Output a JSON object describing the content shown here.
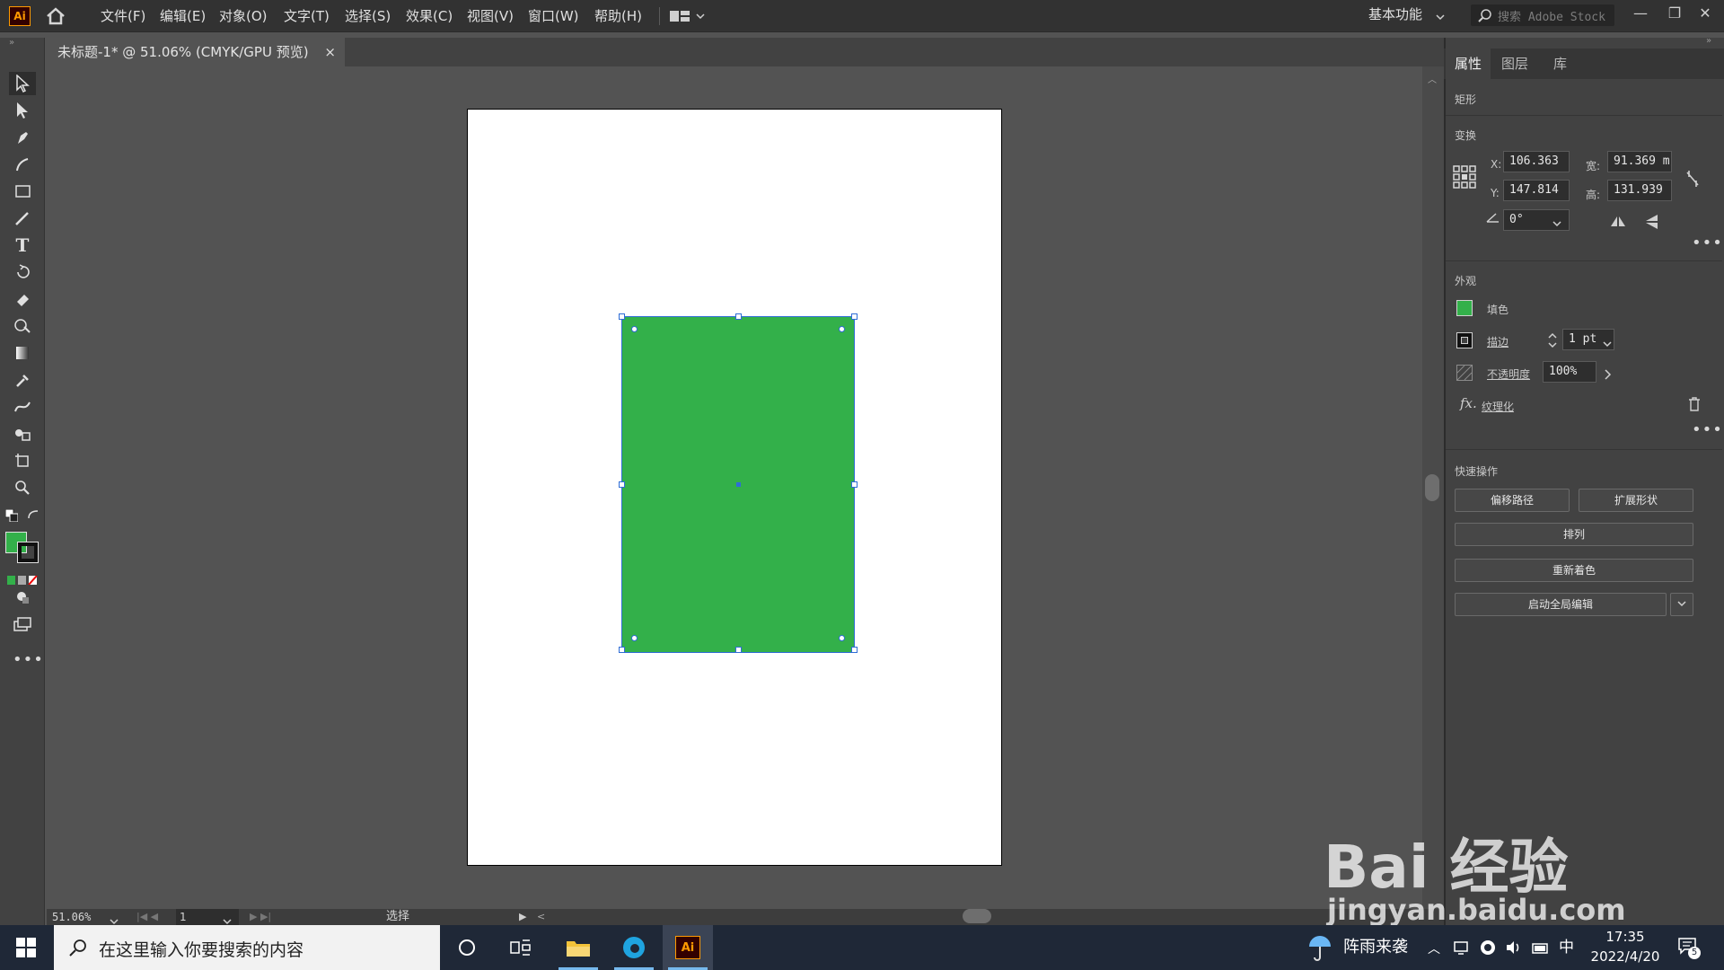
{
  "app": {
    "logo": "Ai",
    "menu": [
      "文件(F)",
      "编辑(E)",
      "对象(O)",
      "文字(T)",
      "选择(S)",
      "效果(C)",
      "视图(V)",
      "窗口(W)",
      "帮助(H)"
    ],
    "workspace": "基本功能",
    "search_placeholder": "搜索 Adobe Stock"
  },
  "document": {
    "tab_title": "未标题-1* @ 51.06% (CMYK/GPU 预览)",
    "close": "×",
    "zoom": "51.06%",
    "page": "1",
    "status_mode": "选择"
  },
  "colors": {
    "fill": "#33b04a",
    "selection": "#2f6dd6",
    "accent": "#ff9a00"
  },
  "properties": {
    "tabs": [
      "属性",
      "图层",
      "库"
    ],
    "object_type": "矩形",
    "transform_title": "变换",
    "x_label": "X:",
    "x": "106.363",
    "y_label": "Y:",
    "y": "147.814",
    "w_label": "宽:",
    "w": "91.369 m",
    "h_label": "高:",
    "h": "131.939",
    "angle": "0°",
    "appearance_title": "外观",
    "fill_label": "填色",
    "stroke_label": "描边",
    "stroke_value": "1 pt",
    "opacity_label": "不透明度",
    "opacity_value": "100%",
    "effect_label": "纹理化",
    "quick_title": "快速操作",
    "btn_offset": "偏移路径",
    "btn_expand": "扩展形状",
    "btn_arrange": "排列",
    "btn_recolor": "重新着色",
    "btn_global": "启动全局编辑"
  },
  "taskbar": {
    "search_placeholder": "在这里输入你要搜索的内容",
    "weather": "阵雨来袭",
    "ime": "中",
    "time": "17:35",
    "date": "2022/4/20",
    "notifications": "5"
  },
  "watermark": {
    "main": "Bai 经验",
    "url": "jingyan.baidu.com"
  }
}
